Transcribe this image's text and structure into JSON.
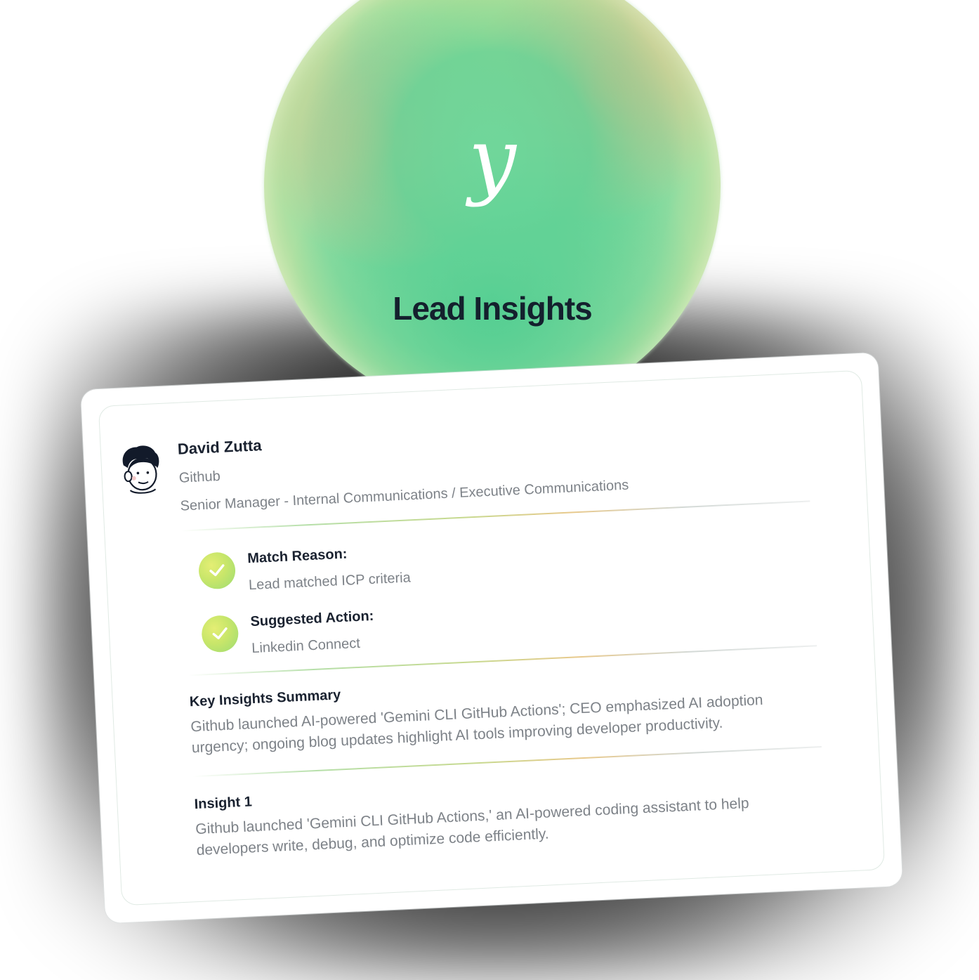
{
  "header": {
    "logo_glyph": "y",
    "title": "Lead Insights"
  },
  "lead": {
    "name": "David Zutta",
    "company": "Github",
    "job_title": "Senior Manager - Internal Communications / Executive Communications"
  },
  "checks": [
    {
      "label": "Match Reason:",
      "value": "Lead matched ICP criteria"
    },
    {
      "label": "Suggested Action:",
      "value": "Linkedin Connect"
    }
  ],
  "summary": {
    "heading": "Key Insights Summary",
    "body": "Github launched AI-powered 'Gemini CLI GitHub Actions'; CEO emphasized AI adoption urgency; ongoing blog updates highlight AI tools improving developer productivity."
  },
  "insight": {
    "heading": "Insight 1",
    "body": "Github launched 'Gemini CLI GitHub Actions,' an AI-powered coding assistant to help developers write, debug, and optimize code efficiently."
  },
  "colors": {
    "orb_green": "#6fd69c",
    "check_fill": "#c8e66a",
    "heading_text": "#1a2230",
    "muted_text": "#7d8288"
  },
  "icons": {
    "logo": "y-script-logo",
    "check": "check-icon",
    "avatar": "cartoon-avatar"
  }
}
